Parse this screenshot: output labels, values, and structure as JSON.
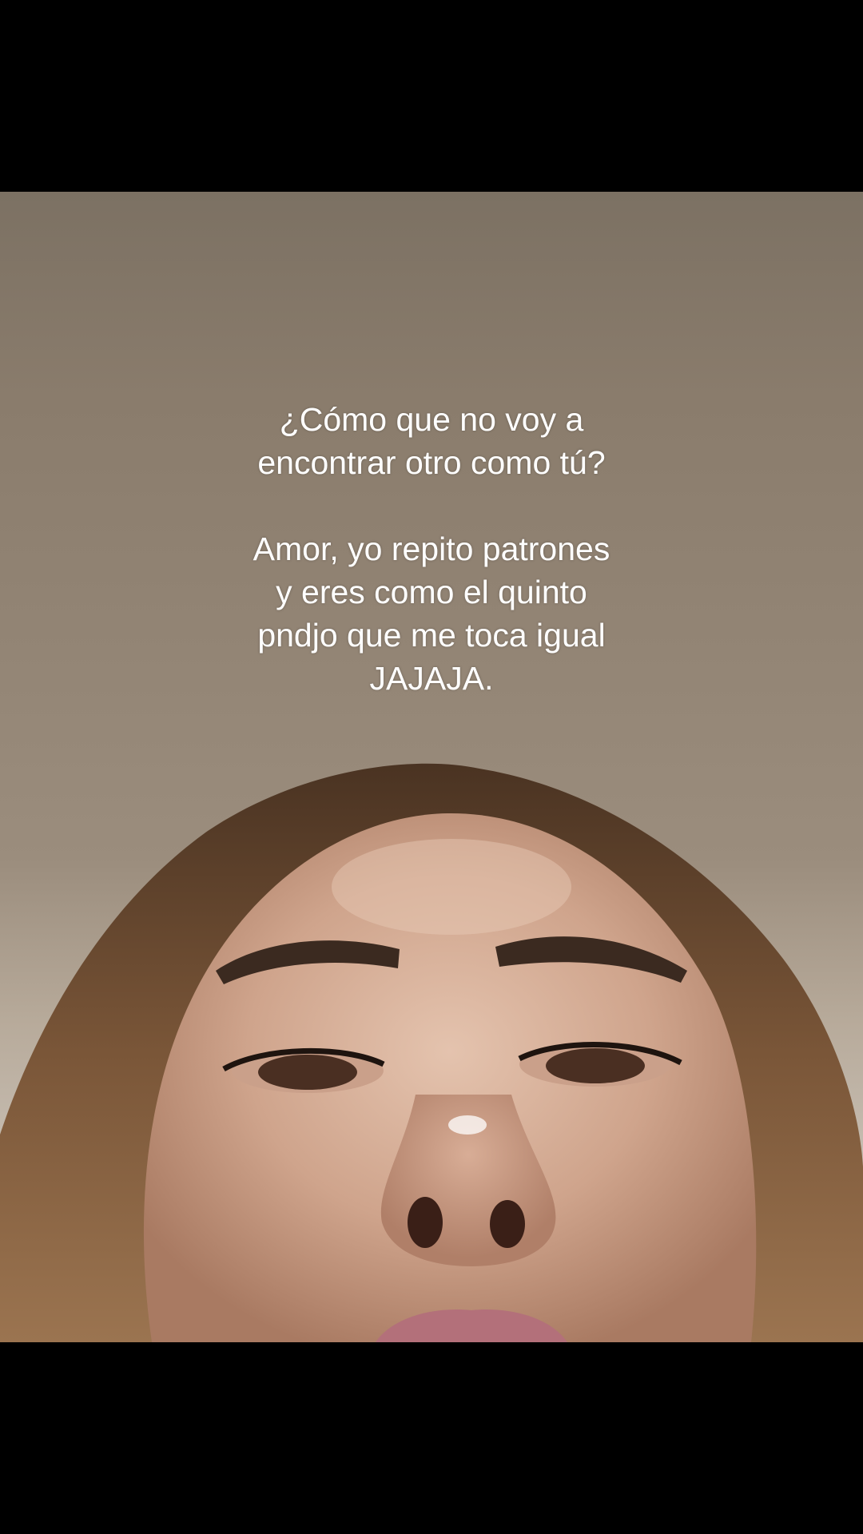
{
  "caption": {
    "line1": "¿Cómo que no voy a",
    "line2": "encontrar otro como tú?",
    "line3": "Amor, yo repito patrones",
    "line4": "y eres como el quinto",
    "line5": "pndjo que me toca igual",
    "line6": "JAJAJA."
  },
  "colors": {
    "letterbox": "#000000",
    "caption_text": "#ffffff",
    "background_top": "#7c7163",
    "background_bottom": "#c7bdb0",
    "hair": "#6b4a2f",
    "skin": "#c89a82",
    "lips": "#b3707a"
  }
}
